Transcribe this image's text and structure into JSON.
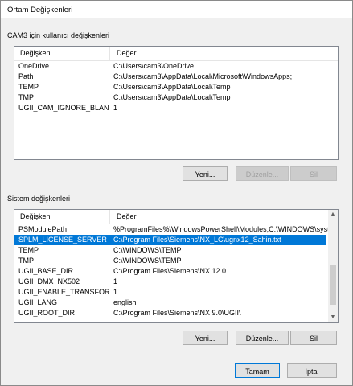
{
  "window": {
    "title": "Ortam Değişkenleri"
  },
  "user_group": {
    "label": "CAM3 için kullanıcı değişkenleri",
    "columns": [
      "Değişken",
      "Değer"
    ],
    "rows": [
      {
        "name": "OneDrive",
        "value": "C:\\Users\\cam3\\OneDrive"
      },
      {
        "name": "Path",
        "value": "C:\\Users\\cam3\\AppData\\Local\\Microsoft\\WindowsApps;"
      },
      {
        "name": "TEMP",
        "value": "C:\\Users\\cam3\\AppData\\Local\\Temp"
      },
      {
        "name": "TMP",
        "value": "C:\\Users\\cam3\\AppData\\Local\\Temp"
      },
      {
        "name": "UGII_CAM_IGNORE_BLANK_...",
        "value": "1"
      }
    ],
    "buttons": {
      "new": "Yeni...",
      "edit": "Düzenle...",
      "delete": "Sil"
    }
  },
  "system_group": {
    "label": "Sistem değişkenleri",
    "columns": [
      "Değişken",
      "Değer"
    ],
    "rows": [
      {
        "name": "PSModulePath",
        "value": "%ProgramFiles%\\WindowsPowerShell\\Modules;C:\\WINDOWS\\syst..."
      },
      {
        "name": "SPLM_LICENSE_SERVER",
        "value": "C:\\Program Files\\Siemens\\NX_LC\\ugnx12_Sahin.txt",
        "selected": true
      },
      {
        "name": "TEMP",
        "value": "C:\\WINDOWS\\TEMP"
      },
      {
        "name": "TMP",
        "value": "C:\\WINDOWS\\TEMP"
      },
      {
        "name": "UGII_BASE_DIR",
        "value": "C:\\Program Files\\Siemens\\NX 12.0"
      },
      {
        "name": "UGII_DMX_NX502",
        "value": "1"
      },
      {
        "name": "UGII_ENABLE_TRANSFORM_...",
        "value": "1"
      },
      {
        "name": "UGII_LANG",
        "value": "english"
      },
      {
        "name": "UGII_ROOT_DIR",
        "value": "C:\\Program Files\\Siemens\\NX 9.0\\UGII\\"
      }
    ],
    "buttons": {
      "new": "Yeni...",
      "edit": "Düzenle...",
      "delete": "Sil"
    }
  },
  "dialog_buttons": {
    "ok": "Tamam",
    "cancel": "İptal"
  },
  "icons": {
    "scroll_up": "up-arrow-icon",
    "scroll_down": "down-arrow-icon"
  },
  "colors": {
    "selection": "#0078d7"
  }
}
